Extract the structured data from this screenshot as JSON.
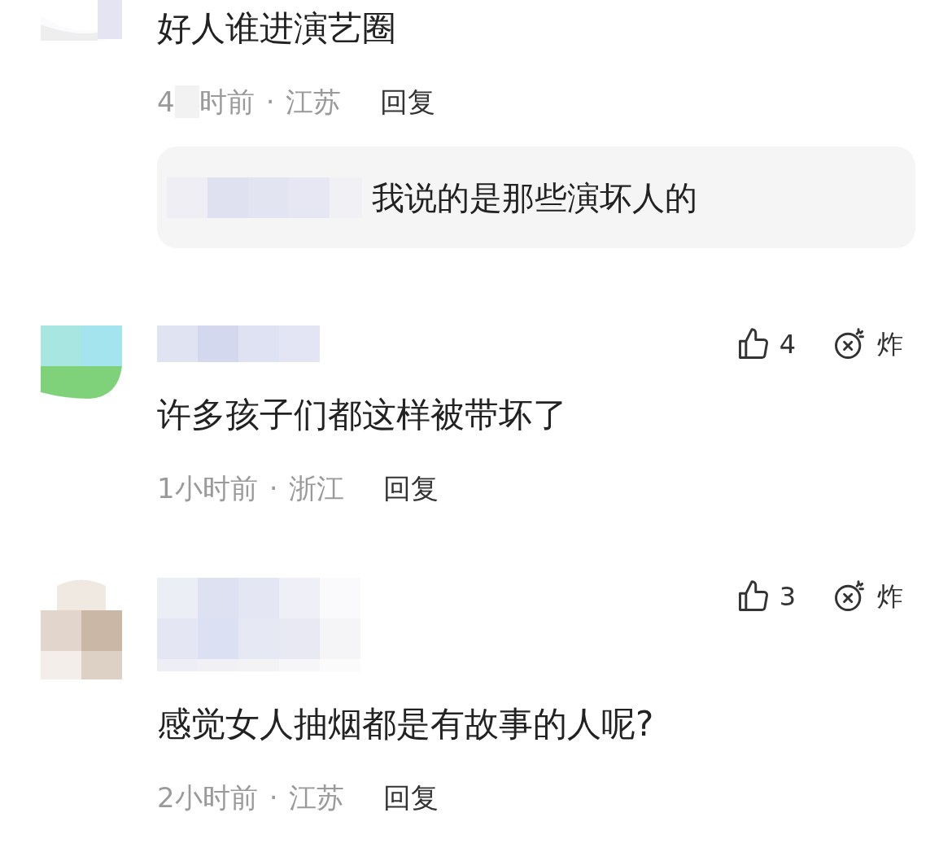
{
  "comments": [
    {
      "text": "好人谁进演艺圈",
      "time_parts": [
        "4",
        "时前"
      ],
      "separator": "·",
      "location": "江苏",
      "reply_label": "回复",
      "replies": [
        {
          "text": "我说的是那些演坏人的"
        }
      ]
    },
    {
      "likes": "4",
      "explode_label": "炸",
      "text": "许多孩子们都这样被带坏了",
      "time_parts": [
        "1小时前"
      ],
      "separator": "·",
      "location": "浙江",
      "reply_label": "回复"
    },
    {
      "likes": "3",
      "explode_label": "炸",
      "text": "感觉女人抽烟都是有故事的人呢?",
      "time_parts": [
        "2小时前"
      ],
      "separator": "·",
      "location": "江苏",
      "reply_label": "回复"
    }
  ]
}
